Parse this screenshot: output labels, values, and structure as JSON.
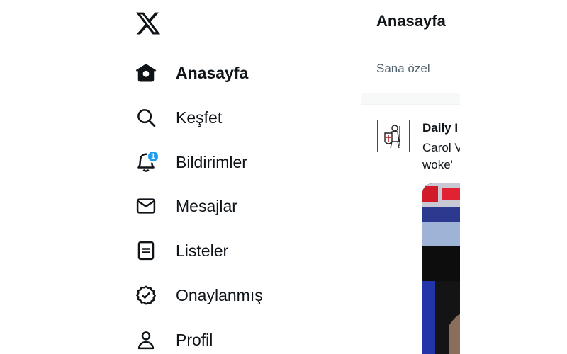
{
  "sidebar": {
    "logo_icon": "x-logo-icon",
    "items": [
      {
        "label": "Anasayfa",
        "icon": "home-icon",
        "active": true
      },
      {
        "label": "Keşfet",
        "icon": "search-icon"
      },
      {
        "label": "Bildirimler",
        "icon": "bell-icon",
        "badge": "1"
      },
      {
        "label": "Mesajlar",
        "icon": "mail-icon"
      },
      {
        "label": "Listeler",
        "icon": "list-icon"
      },
      {
        "label": "Onaylanmış",
        "icon": "verified-icon"
      },
      {
        "label": "Profil",
        "icon": "profile-icon"
      }
    ]
  },
  "main": {
    "title": "Anasayfa",
    "tabs": [
      {
        "label": "Sana özel"
      }
    ],
    "tweet": {
      "author": "Daily I",
      "text_lines": [
        "Carol V",
        "woke'"
      ]
    }
  },
  "colors": {
    "accent": "#1d9bf0",
    "text": "#0f1419",
    "secondary_text": "#536471",
    "border": "#eff3f4"
  }
}
